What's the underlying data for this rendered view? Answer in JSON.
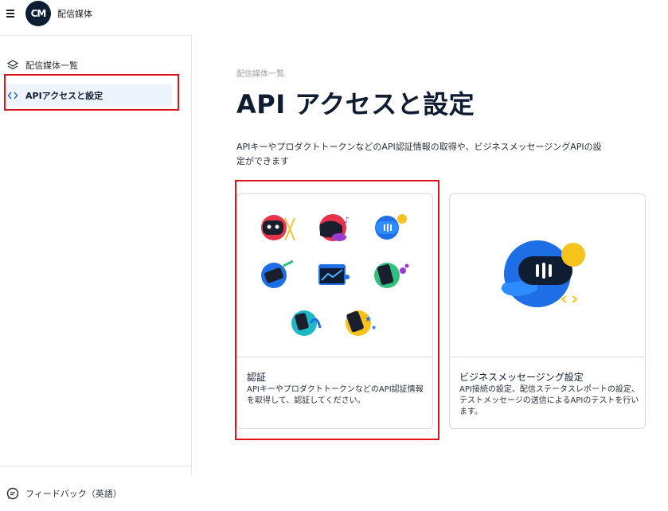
{
  "app": {
    "title": "配信媒体",
    "logo_text": "CM"
  },
  "sidebar": {
    "items": [
      {
        "label": "配信媒体一覧",
        "icon": "layers-icon"
      },
      {
        "label": "APIアクセスと設定",
        "icon": "code-icon",
        "active": true
      }
    ],
    "footer": {
      "label": "フィードバック（英語）",
      "icon": "feedback-icon"
    }
  },
  "main": {
    "breadcrumb": "配信媒体一覧",
    "title": "API アクセスと設定",
    "description": "APIキーやプロダクトトークンなどのAPI認証情報の取得や、ビジネスメッセージングAPIの設定ができます",
    "cards": [
      {
        "title": "認証",
        "description": "APIキーやプロダクトトークンなどのAPI認証情報を取得して、認証してください。"
      },
      {
        "title": "ビジネスメッセージング設定",
        "description": "API接続の設定、配信ステータスレポートの設定、テストメッセージの送信によるAPIのテストを行います。"
      }
    ]
  },
  "colors": {
    "accent": "#1e6fe6",
    "highlight": "#e0121a",
    "dark": "#0f1d33",
    "active_bg": "#eef4fb"
  }
}
